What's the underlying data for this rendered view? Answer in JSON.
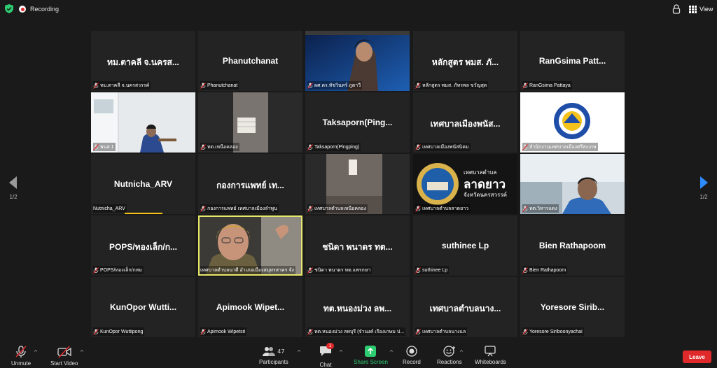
{
  "topbar": {
    "recording_label": "Recording",
    "view_label": "View"
  },
  "tiles": [
    {
      "name": "ทม.ตาคลี จ.นครส...",
      "caption": "ทม.ตาคลี จ.นครสวรรค์",
      "muted": true
    },
    {
      "name": "Phanutchanat",
      "caption": "Phanutchanat",
      "muted": true
    },
    {
      "name": "",
      "caption": "ผศ.ดร.ทัชวินทร์ ภูดาวี",
      "muted": true,
      "video": "laptop"
    },
    {
      "name": "หลักสูตร พมส. ภั...",
      "caption": "หลักสูตร พมส. ภัทรพล ขวัญสุด",
      "muted": true
    },
    {
      "name": "RanGsima   Patt...",
      "caption": "RanGsima  Pattaya",
      "muted": true
    },
    {
      "name": "",
      "caption": "พนส.1",
      "muted": true,
      "video": "office"
    },
    {
      "name": "",
      "caption": "ทต.เหนือคลอง",
      "muted": true,
      "video": "ceiling"
    },
    {
      "name": "Taksaporn(Ping...",
      "caption": "Taksaporn(Pingping)",
      "muted": true
    },
    {
      "name": "เทศบาลเมืองพนัส...",
      "caption": "เทศบาลเมืองพนัสนิคม",
      "muted": true
    },
    {
      "name": "",
      "caption": "สำนักงานเทศบาลเมืองศรีสะเกษ",
      "muted": true,
      "video": "logo"
    },
    {
      "name": "Nutnicha_ARV",
      "caption": "Nutnicha_ARV",
      "muted": false
    },
    {
      "name": "กองการแพทย์ เท...",
      "caption": "กองการแพทย์ เทศบาลเมืองลำพูน",
      "muted": true
    },
    {
      "name": "",
      "caption": "เทศบาลตำบลเหนือคลอง",
      "muted": true,
      "video": "ceiling2"
    },
    {
      "name": "",
      "caption": "เทศบาลตำบลลาดยาว",
      "muted": true,
      "video": "banner",
      "banner_line1": "เทศบาลตำบล",
      "banner_line2": "ลาดยาว",
      "banner_line3": "จังหวัดนครสวรรค์"
    },
    {
      "name": "",
      "caption": "ทต.วิหารแดง",
      "muted": true,
      "video": "man"
    },
    {
      "name": "POPS/ทองเล็ก/ก...",
      "caption": "POPS/ทองเล็ก/กหม",
      "muted": true
    },
    {
      "name": "",
      "caption": "เทศบาลตำบลนาดี อำเภอเมืองสมุทรสาคร จัง",
      "muted": false,
      "video": "woman",
      "active": true
    },
    {
      "name": "ชนิดา พนาดร ทต...",
      "caption": "ชนิดา พนาดร ทต.แพรกษา",
      "muted": true
    },
    {
      "name": "suthinee Lp",
      "caption": "suthinee Lp",
      "muted": true
    },
    {
      "name": "Bien Rathapoom",
      "caption": "Bien Rathapoom",
      "muted": true
    },
    {
      "name": "KunOpor Wutti...",
      "caption": "KunOpor Wuttipong",
      "muted": true
    },
    {
      "name": "Apimook  Wipet...",
      "caption": "Apimook Wipetsri",
      "muted": true
    },
    {
      "name": "ทต.หนองม่วง ลพ...",
      "caption": "ทต.หนองม่วง ลพบุรี (จำนงค์ เรืองเกษม ป...",
      "muted": true
    },
    {
      "name": "เทศบาลตำบลนาง...",
      "caption": "เทศบาลตำบลนางแล",
      "muted": true
    },
    {
      "name": "Yoresore  Sirib...",
      "caption": "Yoresore Siriboonyachai",
      "muted": true
    }
  ],
  "pager": {
    "left": "1/2",
    "right": "1/2"
  },
  "toolbar": {
    "unmute": "Unmute",
    "start_video": "Start Video",
    "participants": "Participants",
    "participants_count": "47",
    "chat": "Chat",
    "chat_badge": "1",
    "share_screen": "Share Screen",
    "record": "Record",
    "reactions": "Reactions",
    "whiteboards": "Whiteboards",
    "leave": "Leave"
  },
  "colors": {
    "accent_red": "#e0292b",
    "share_green": "#2ecc71",
    "active_speaker": "#e6e86b"
  }
}
